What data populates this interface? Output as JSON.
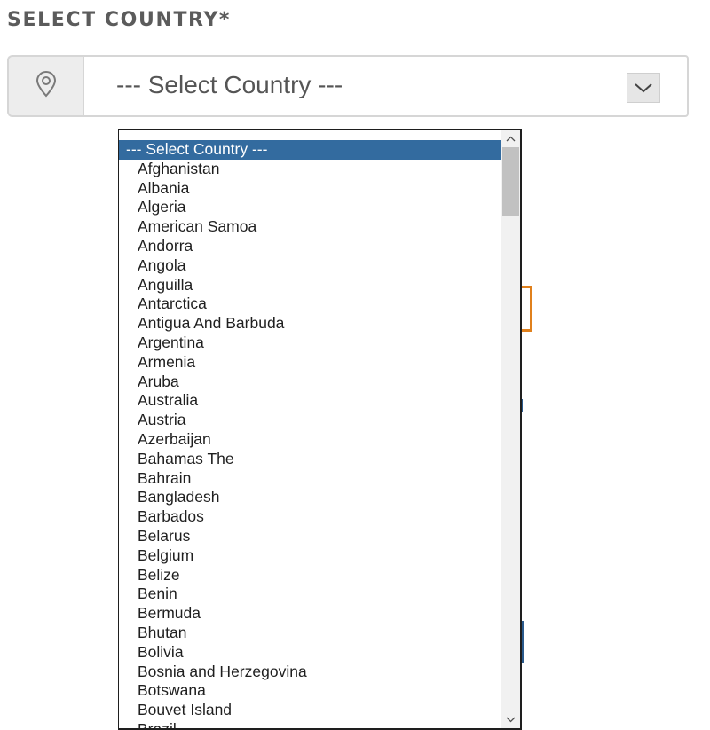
{
  "field": {
    "label": "SELECT COUNTRY*",
    "selected_value": "--- Select Country ---",
    "addon_icon": "location-pin-icon",
    "dropdown_icon": "chevron-down-icon"
  },
  "dropdown": {
    "options": [
      "--- Select Country ---",
      "Afghanistan",
      "Albania",
      "Algeria",
      "American Samoa",
      "Andorra",
      "Angola",
      "Anguilla",
      "Antarctica",
      "Antigua And Barbuda",
      "Argentina",
      "Armenia",
      "Aruba",
      "Australia",
      "Austria",
      "Azerbaijan",
      "Bahamas The",
      "Bahrain",
      "Bangladesh",
      "Barbados",
      "Belarus",
      "Belgium",
      "Belize",
      "Benin",
      "Bermuda",
      "Bhutan",
      "Bolivia",
      "Bosnia and Herzegovina",
      "Botswana",
      "Bouvet Island",
      "Brazil"
    ],
    "selected_index": 0,
    "highlight_color": "#336b9f"
  },
  "colors": {
    "label_text": "#5b5b5b",
    "accent_orange": "#e0801c"
  }
}
